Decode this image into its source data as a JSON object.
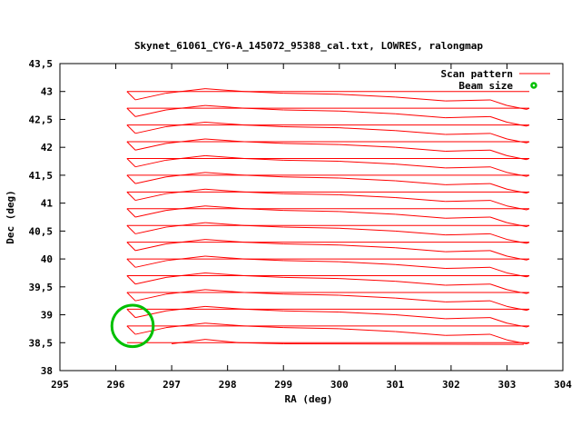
{
  "chart_data": {
    "type": "line",
    "title": "Skynet_61061_CYG-A_145072_95388_cal.txt, LOWRES, ralongmap",
    "xlabel": "RA (deg)",
    "ylabel": "Dec (deg)",
    "xlim": [
      295,
      304
    ],
    "ylim": [
      38,
      43.5
    ],
    "xticks": [
      "295",
      "296",
      "297",
      "298",
      "299",
      "300",
      "301",
      "302",
      "303",
      "304"
    ],
    "xtick_values": [
      295,
      296,
      297,
      298,
      299,
      300,
      301,
      302,
      303,
      304
    ],
    "yticks": [
      "38",
      "38,5",
      "39",
      "39,5",
      "40",
      "40,5",
      "41",
      "41,5",
      "42",
      "42,5",
      "43",
      "43,5"
    ],
    "ytick_values": [
      38,
      38.5,
      39,
      39.5,
      40,
      40.5,
      41,
      41.5,
      42,
      42.5,
      43,
      43.5
    ],
    "grid": false,
    "legend": {
      "placement": "top-right",
      "entries": [
        {
          "label": "Scan pattern",
          "color": "#ff0000"
        },
        {
          "label": "Beam size",
          "color": "#00c000"
        }
      ]
    },
    "scan_pattern": {
      "color": "#ff0000",
      "return_start_dec": 43.0,
      "scan_step_dec": 0.3,
      "scan_count": 15,
      "return_ra": [
        296.2,
        303.4
      ],
      "sweep_start_dec": 42.85,
      "sweep_profile": {
        "ra": [
          296.35,
          296.9,
          297.6,
          298.3,
          299.0,
          300.0,
          301.0,
          301.9,
          302.7,
          303.0,
          303.35
        ],
        "ddec": [
          0,
          0.12,
          0.2,
          0.15,
          0.12,
          0.1,
          0.05,
          -0.02,
          0.0,
          -0.1,
          -0.17
        ]
      },
      "final_sweep": {
        "ra": [
          297.0,
          297.6,
          298.2,
          299.0,
          303.3
        ],
        "dec": [
          38.48,
          38.56,
          38.5,
          38.48,
          38.47
        ]
      }
    },
    "beam": {
      "ra": 296.3,
      "dec": 38.8,
      "radius_deg": 0.37,
      "color": "#00c000"
    }
  }
}
